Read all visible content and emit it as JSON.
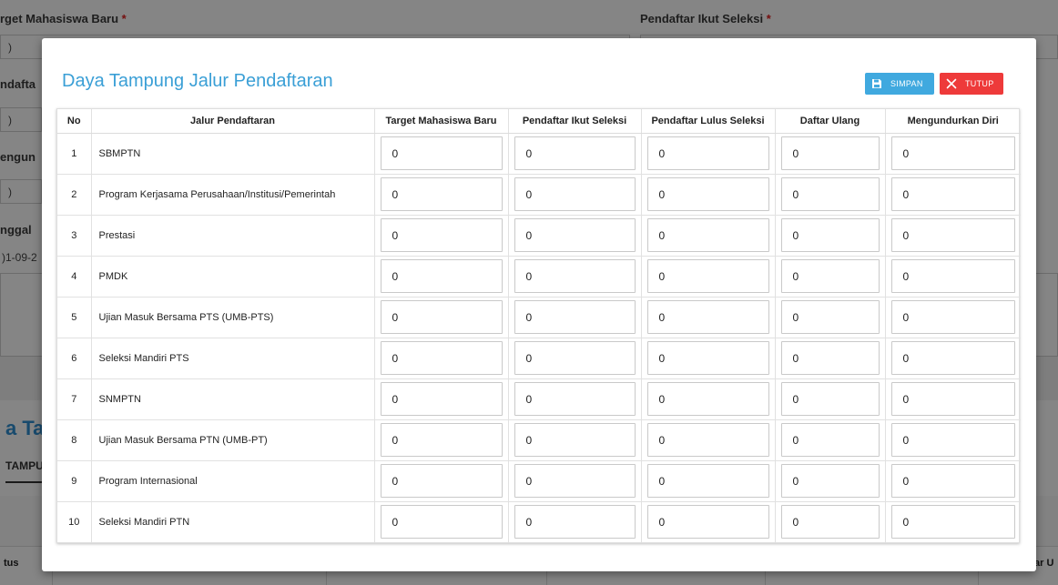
{
  "background": {
    "top_left_label": "rget Mahasiswa Baru",
    "top_right_label": "Pendaftar Ikut Seleksi",
    "required_mark": "*",
    "left_fragments": [
      ")",
      "ndafta",
      ")",
      "engun",
      ")",
      "nggal",
      ")1-09-2"
    ],
    "section_heading": "a Ta",
    "tab_label": "TAMPU",
    "bottom_left_header": "tus",
    "bottom_right_header": "ar U"
  },
  "modal": {
    "title": "Daya Tampung Jalur Pendaftaran",
    "save_label": "SIMPAN",
    "close_label": "TUTUP",
    "columns": {
      "no": "No",
      "jalur": "Jalur Pendaftaran",
      "target": "Target Mahasiswa Baru",
      "ikut": "Pendaftar Ikut Seleksi",
      "lulus": "Pendaftar Lulus Seleksi",
      "daftar_ulang": "Daftar Ulang",
      "mundur": "Mengundurkan Diri"
    },
    "rows": [
      {
        "no": "1",
        "jalur": "SBMPTN",
        "target": "0",
        "ikut": "0",
        "lulus": "0",
        "daftar_ulang": "0",
        "mundur": "0"
      },
      {
        "no": "2",
        "jalur": "Program Kerjasama Perusahaan/Institusi/Pemerintah",
        "target": "0",
        "ikut": "0",
        "lulus": "0",
        "daftar_ulang": "0",
        "mundur": "0"
      },
      {
        "no": "3",
        "jalur": "Prestasi",
        "target": "0",
        "ikut": "0",
        "lulus": "0",
        "daftar_ulang": "0",
        "mundur": "0"
      },
      {
        "no": "4",
        "jalur": "PMDK",
        "target": "0",
        "ikut": "0",
        "lulus": "0",
        "daftar_ulang": "0",
        "mundur": "0"
      },
      {
        "no": "5",
        "jalur": "Ujian Masuk Bersama PTS (UMB-PTS)",
        "target": "0",
        "ikut": "0",
        "lulus": "0",
        "daftar_ulang": "0",
        "mundur": "0"
      },
      {
        "no": "6",
        "jalur": "Seleksi Mandiri PTS",
        "target": "0",
        "ikut": "0",
        "lulus": "0",
        "daftar_ulang": "0",
        "mundur": "0"
      },
      {
        "no": "7",
        "jalur": "SNMPTN",
        "target": "0",
        "ikut": "0",
        "lulus": "0",
        "daftar_ulang": "0",
        "mundur": "0"
      },
      {
        "no": "8",
        "jalur": "Ujian Masuk Bersama PTN (UMB-PT)",
        "target": "0",
        "ikut": "0",
        "lulus": "0",
        "daftar_ulang": "0",
        "mundur": "0"
      },
      {
        "no": "9",
        "jalur": "Program Internasional",
        "target": "0",
        "ikut": "0",
        "lulus": "0",
        "daftar_ulang": "0",
        "mundur": "0"
      },
      {
        "no": "10",
        "jalur": "Seleksi Mandiri PTN",
        "target": "0",
        "ikut": "0",
        "lulus": "0",
        "daftar_ulang": "0",
        "mundur": "0"
      }
    ]
  },
  "colors": {
    "accent": "#3a9fd6",
    "save_button": "#40a9df",
    "close_button": "#ee3a3a",
    "required": "#e02020"
  },
  "icons": {
    "save": "floppy-disk-icon",
    "close": "close-x-icon"
  }
}
